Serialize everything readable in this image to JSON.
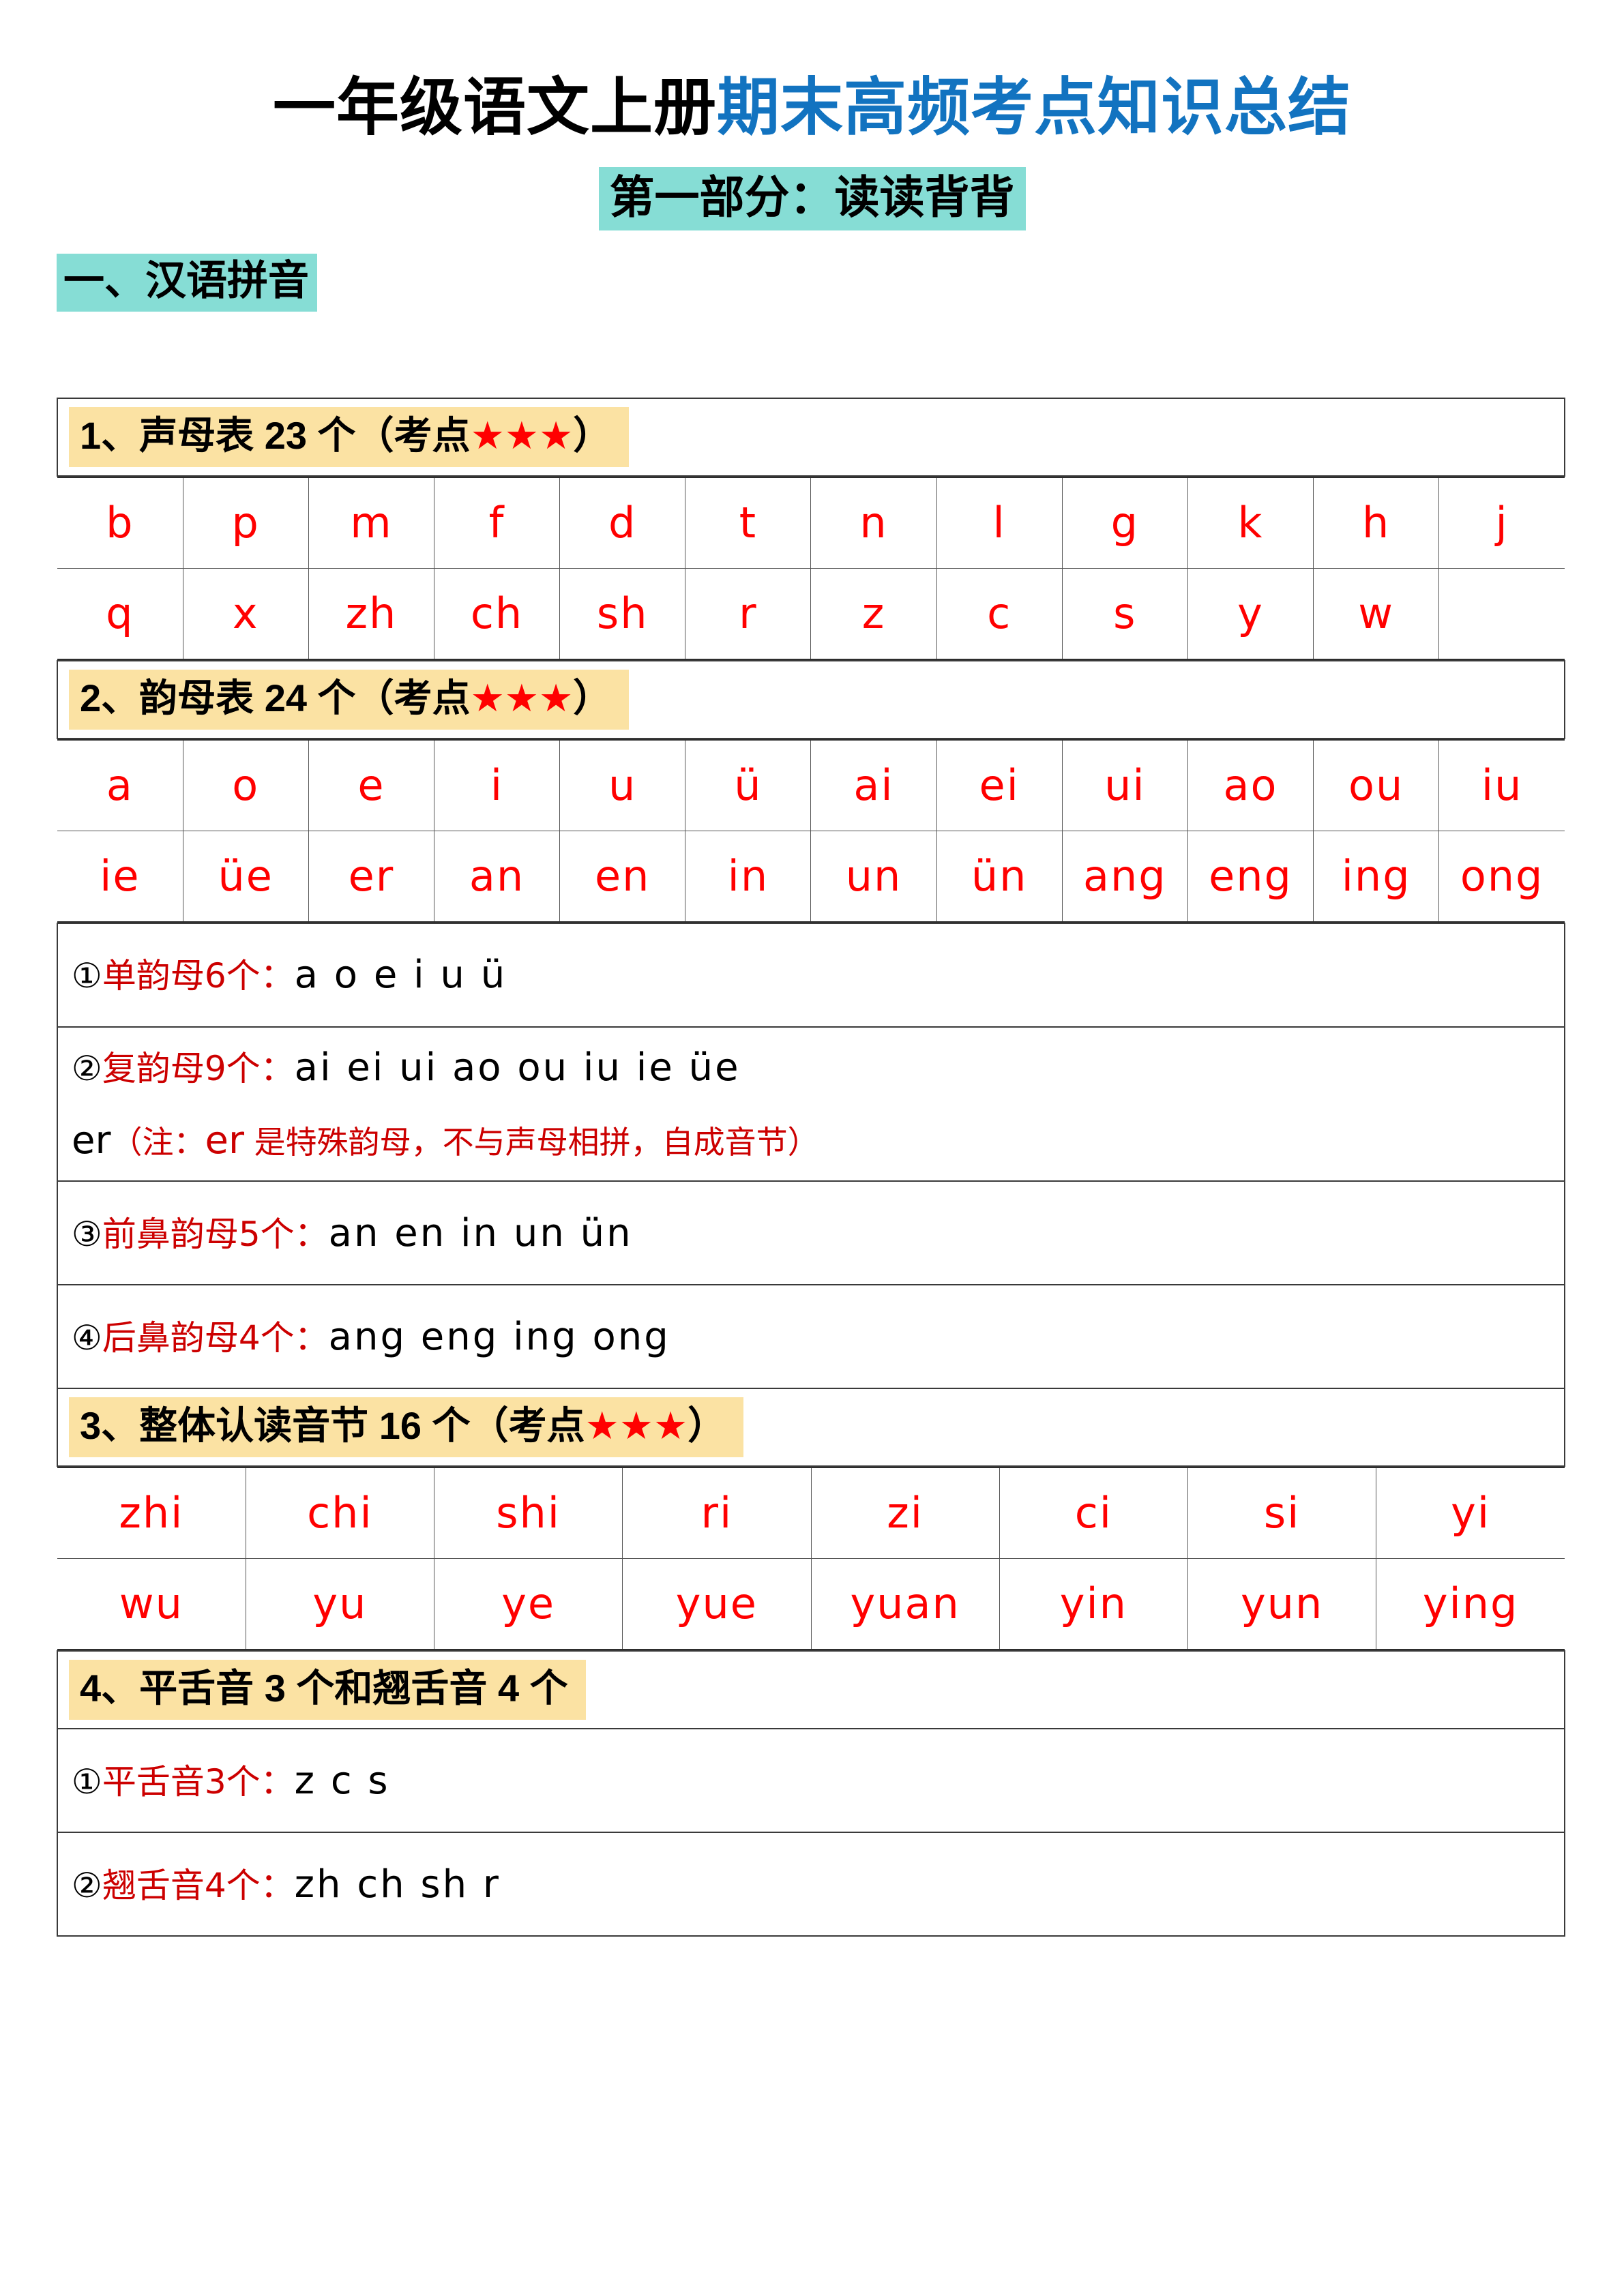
{
  "title": {
    "black_part": "一年级语文上册",
    "blue_part": "期末高频考点知识总结",
    "blue_color": "#1273C0"
  },
  "subtitle": {
    "text": "第一部分：读读背背",
    "highlight_color": "#86DDD5"
  },
  "section": {
    "label": "一、汉语拼音",
    "highlight_color": "#86DDD5"
  },
  "colors": {
    "band_yellow": "#FBE2A3",
    "letter_red": "#FF0000",
    "label_red": "#CC0000",
    "border": "#3a3a3a"
  },
  "blocks": [
    {
      "id": "shengmu",
      "heading_prefix": "1、声母表 23 个（考点",
      "heading_stars": "★★★",
      "heading_suffix": "）",
      "grid": {
        "columns": 12,
        "rows": [
          [
            "b",
            "p",
            "m",
            "f",
            "d",
            "t",
            "n",
            "l",
            "g",
            "k",
            "h",
            "j"
          ],
          [
            "q",
            "x",
            "zh",
            "ch",
            "sh",
            "r",
            "z",
            "c",
            "s",
            "y",
            "w",
            ""
          ]
        ]
      }
    },
    {
      "id": "yunmu",
      "heading_prefix": "2、韵母表 24 个（考点",
      "heading_stars": "★★★",
      "heading_suffix": "）",
      "grid": {
        "columns": 12,
        "rows": [
          [
            "a",
            "o",
            "e",
            "i",
            "u",
            "ü",
            "ai",
            "ei",
            "ui",
            "ao",
            "ou",
            "iu"
          ],
          [
            "ie",
            "üe",
            "er",
            "an",
            "en",
            "in",
            "un",
            "ün",
            "ang",
            "eng",
            "ing",
            "ong"
          ]
        ]
      }
    }
  ],
  "yunmu_details": [
    {
      "circle": "①",
      "label": "单韵母",
      "count": "6",
      "unit": "个",
      "colon": "：",
      "values": "a   o   e   i   u   ü"
    },
    {
      "circle": "②",
      "label": "复韵母",
      "count": "9",
      "unit": "个",
      "colon": "：",
      "values": "ai   ei   ui   ao   ou   iu   ie   üe",
      "second_line_prefix": "er",
      "second_line_note": "（注：",
      "second_line_er": "er",
      "second_line_rest": " 是特殊韵母，不与声母相拼，自成音节）"
    },
    {
      "circle": "③",
      "label": "前鼻韵母",
      "count": "5",
      "unit": "个",
      "colon": "：",
      "values": "an   en   in   un   ün"
    },
    {
      "circle": "④",
      "label": "后鼻韵母",
      "count": "4",
      "unit": "个",
      "colon": "：",
      "values": "ang   eng   ing   ong"
    }
  ],
  "zhengti": {
    "heading_prefix": "3、整体认读音节 16 个（考点",
    "heading_stars": "★★★",
    "heading_suffix": "）",
    "grid": {
      "columns": 8,
      "rows": [
        [
          "zhi",
          "chi",
          "shi",
          "ri",
          "zi",
          "ci",
          "si",
          "yi"
        ],
        [
          "wu",
          "yu",
          "ye",
          "yue",
          "yuan",
          "yin",
          "yun",
          "ying"
        ]
      ]
    }
  },
  "sheyin": {
    "heading": "4、平舌音 3 个和翘舌音 4 个",
    "items": [
      {
        "circle": "①",
        "label": "平舌音",
        "count": "3",
        "unit": "个",
        "colon": "：",
        "values": "z    c    s"
      },
      {
        "circle": "②",
        "label": "翘舌音",
        "count": "4",
        "unit": "个",
        "colon": "：",
        "values": "zh    ch    sh    r"
      }
    ]
  }
}
